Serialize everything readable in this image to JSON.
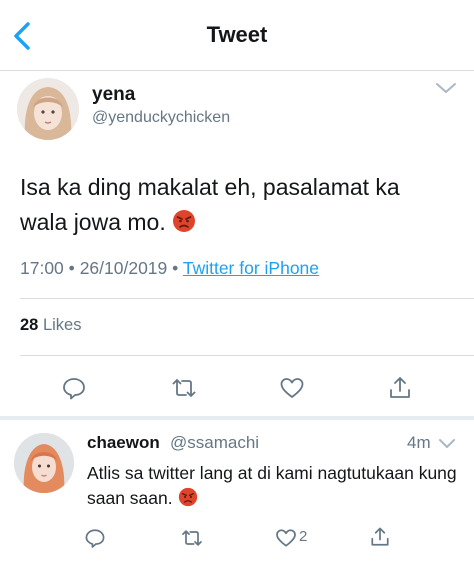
{
  "nav": {
    "title": "Tweet"
  },
  "tweet": {
    "name": "yena",
    "handle": "@yenduckychicken",
    "text": "Isa ka ding makalat eh, pasalamat ka wala jowa mo.",
    "time": "17:00",
    "date": "26/10/2019",
    "source": "Twitter for iPhone",
    "likes_count": "28",
    "likes_label": "Likes"
  },
  "reply": {
    "name": "chaewon",
    "handle": "@ssamachi",
    "time": "4m",
    "text": "Atlis sa twitter lang at di kami nagtutukaan kung saan saan.",
    "like_count": "2"
  },
  "colors": {
    "accent": "#1da1f2",
    "secondary": "#657786",
    "emoji_red": "#e0432b"
  },
  "icons": [
    "back-chevron-icon",
    "chevron-down-icon",
    "reply-icon",
    "retweet-icon",
    "like-icon",
    "share-icon",
    "angry-face-emoji"
  ]
}
